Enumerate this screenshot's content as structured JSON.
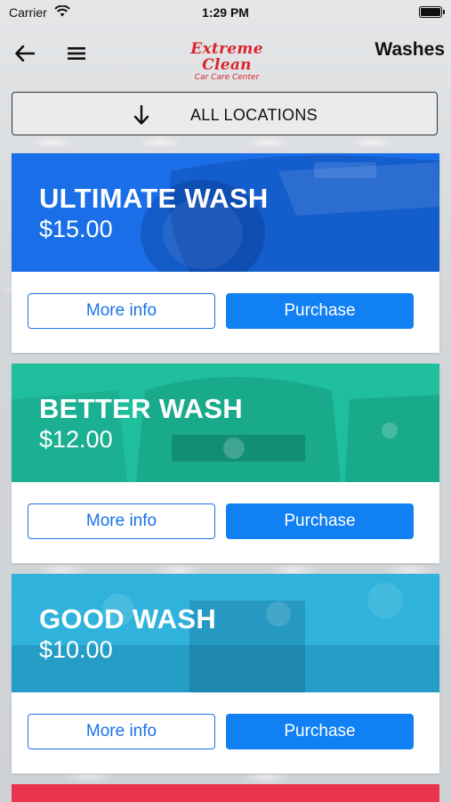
{
  "status_bar": {
    "carrier": "Carrier",
    "time": "1:29 PM"
  },
  "nav": {
    "back_icon": "arrow-left-icon",
    "menu_icon": "hamburger-menu-icon",
    "logo": {
      "main": "Extreme Clean",
      "sub": "Car Care Center"
    },
    "title": "Washes"
  },
  "location_selector": {
    "icon": "arrow-down-icon",
    "label": "ALL LOCATIONS"
  },
  "washes": [
    {
      "name": "ULTIMATE WASH",
      "price": "$15.00",
      "color": "#1a6fe8",
      "more_info": "More info",
      "purchase": "Purchase"
    },
    {
      "name": "BETTER WASH",
      "price": "$12.00",
      "color": "#1fbf9e",
      "more_info": "More info",
      "purchase": "Purchase"
    },
    {
      "name": "GOOD WASH",
      "price": "$10.00",
      "color": "#2fb3dc",
      "more_info": "More info",
      "purchase": "Purchase"
    }
  ],
  "next_card_color": "#e8344d",
  "colors": {
    "accent": "#1180f2",
    "logo_red": "#d9252e"
  }
}
